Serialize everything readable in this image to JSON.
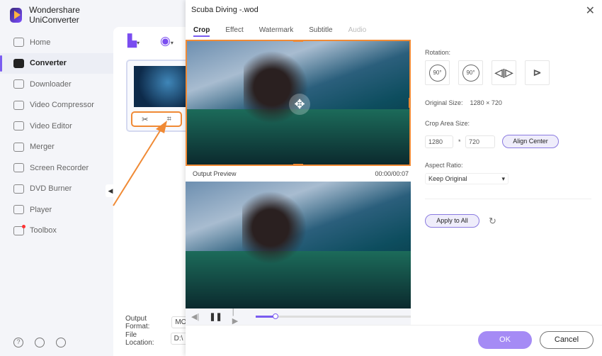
{
  "app": {
    "title": "Wondershare UniConverter"
  },
  "sidebar": {
    "items": [
      {
        "label": "Home",
        "icon": "home-icon"
      },
      {
        "label": "Converter",
        "icon": "converter-icon",
        "active": true
      },
      {
        "label": "Downloader",
        "icon": "download-icon"
      },
      {
        "label": "Video Compressor",
        "icon": "compress-icon"
      },
      {
        "label": "Video Editor",
        "icon": "scissors-icon"
      },
      {
        "label": "Merger",
        "icon": "merge-icon"
      },
      {
        "label": "Screen Recorder",
        "icon": "record-icon"
      },
      {
        "label": "DVD Burner",
        "icon": "disc-icon"
      },
      {
        "label": "Player",
        "icon": "play-icon"
      },
      {
        "label": "Toolbox",
        "icon": "grid-icon"
      }
    ]
  },
  "main": {
    "output_format_label": "Output Format:",
    "output_format_value": "MOV",
    "file_location_label": "File Location:",
    "file_location_value": "D:\\"
  },
  "dialog": {
    "title": "Scuba Diving -.wod",
    "tabs": [
      "Crop",
      "Effect",
      "Watermark",
      "Subtitle",
      "Audio"
    ],
    "output_preview_label": "Output Preview",
    "time": "00:00/00:07",
    "progress": 0.13,
    "rotation_label": "Rotation:",
    "rot_cw": "90°",
    "rot_ccw": "90°",
    "original_size_label": "Original Size:",
    "original_size_value": "1280 × 720",
    "crop_area_label": "Crop Area Size:",
    "crop_width": "1280",
    "crop_sep": "*",
    "crop_height": "720",
    "align_center": "Align Center",
    "aspect_ratio_label": "Aspect Ratio:",
    "aspect_ratio_value": "Keep Original",
    "apply_all": "Apply to All",
    "ok": "OK",
    "cancel": "Cancel"
  },
  "colors": {
    "accent": "#7a5cf0",
    "highlight": "#f08a35"
  }
}
